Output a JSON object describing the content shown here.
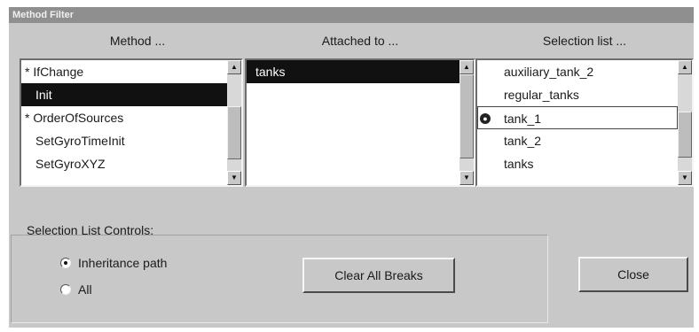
{
  "window": {
    "title": "Method Filter"
  },
  "columns": {
    "method": {
      "header": "Method ...",
      "items": [
        {
          "label": "* IfChange"
        },
        {
          "label": "Init"
        },
        {
          "label": "* OrderOfSources"
        },
        {
          "label": "SetGyroTimeInit"
        },
        {
          "label": "SetGyroXYZ"
        }
      ],
      "selected_index": 1
    },
    "attached": {
      "header": "Attached to ...",
      "items": [
        {
          "label": "tanks"
        }
      ],
      "selected_index": 0
    },
    "selection": {
      "header": "Selection list ...",
      "items": [
        {
          "label": "auxiliary_tank_2"
        },
        {
          "label": "regular_tanks"
        },
        {
          "label": "tank_1",
          "marker_icon": "breakpoint-icon"
        },
        {
          "label": "tank_2"
        },
        {
          "label": "tanks"
        }
      ],
      "focused_index": 2
    }
  },
  "controls": {
    "label": "Selection List Controls:",
    "radios": [
      {
        "label": "Inheritance path",
        "checked": true
      },
      {
        "label": "All",
        "checked": false
      }
    ]
  },
  "buttons": {
    "clear_all_breaks": "Clear All Breaks",
    "close": "Close"
  },
  "icons": {
    "scroll_up": "up-arrow-icon",
    "scroll_down": "down-arrow-icon"
  }
}
